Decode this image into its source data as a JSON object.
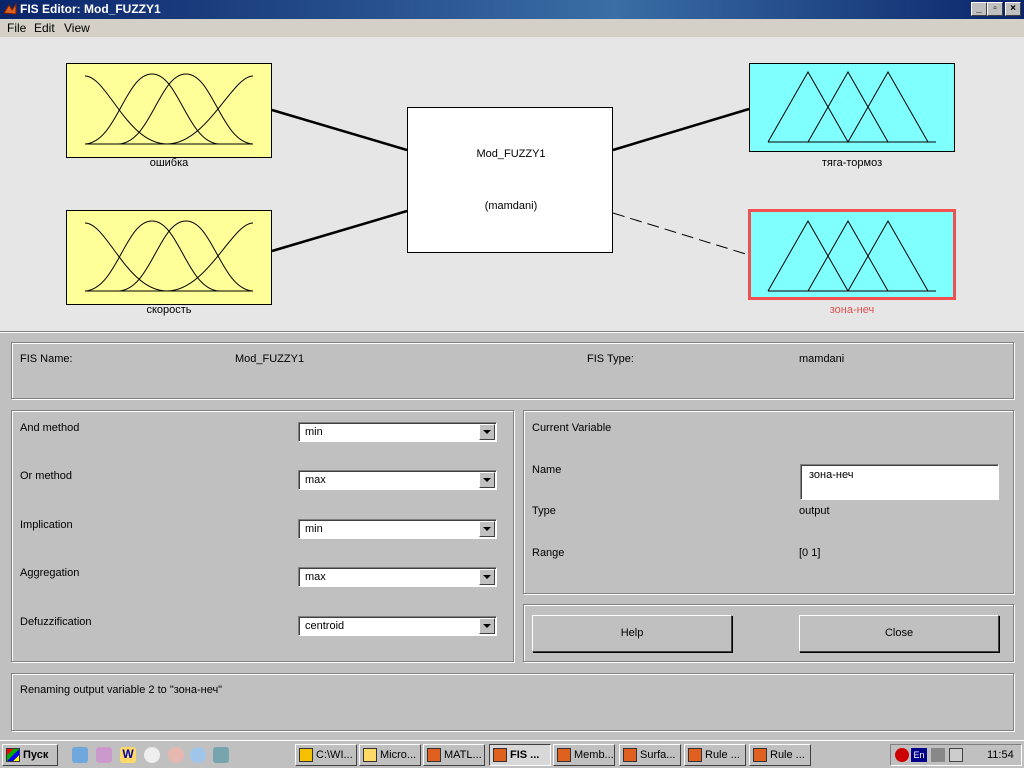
{
  "window": {
    "title": "FIS Editor: Mod_FUZZY1"
  },
  "menu": [
    "File",
    "Edit",
    "View"
  ],
  "diagram": {
    "inputs": [
      {
        "label": "ошибка"
      },
      {
        "label": "скорость"
      }
    ],
    "outputs": [
      {
        "label": "тяга-тормоз",
        "selected": false
      },
      {
        "label": "зона-неч",
        "selected": true
      }
    ],
    "system": {
      "name": "Mod_FUZZY1",
      "type": "(mamdani)"
    },
    "colors": {
      "input": "#ffff99",
      "output": "#80ffff",
      "selected": "#ff4040",
      "selected_label": "#e05050"
    }
  },
  "fis": {
    "name_label": "FIS Name:",
    "name_value": "Mod_FUZZY1",
    "type_label": "FIS Type:",
    "type_value": "mamdani"
  },
  "methods": [
    {
      "label": "And method",
      "value": "min"
    },
    {
      "label": "Or method",
      "value": "max"
    },
    {
      "label": "Implication",
      "value": "min"
    },
    {
      "label": "Aggregation",
      "value": "max"
    },
    {
      "label": "Defuzzification",
      "value": "centroid"
    }
  ],
  "current_variable": {
    "header": "Current Variable",
    "name_label": "Name",
    "name_value": "зона-неч",
    "type_label": "Type",
    "type_value": "output",
    "range_label": "Range",
    "range_value": "[0 1]"
  },
  "buttons": {
    "help": "Help",
    "close": "Close"
  },
  "status": "Renaming output variable 2 to \"зона-неч\"",
  "taskbar": {
    "start": "Пуск",
    "tasks": [
      "C:\\WI...",
      "Micro...",
      "MATL...",
      "FIS ...",
      "Memb...",
      "Surfa...",
      "Rule ...",
      "Rule ..."
    ],
    "tray_lang": "En",
    "clock": "11:54"
  }
}
